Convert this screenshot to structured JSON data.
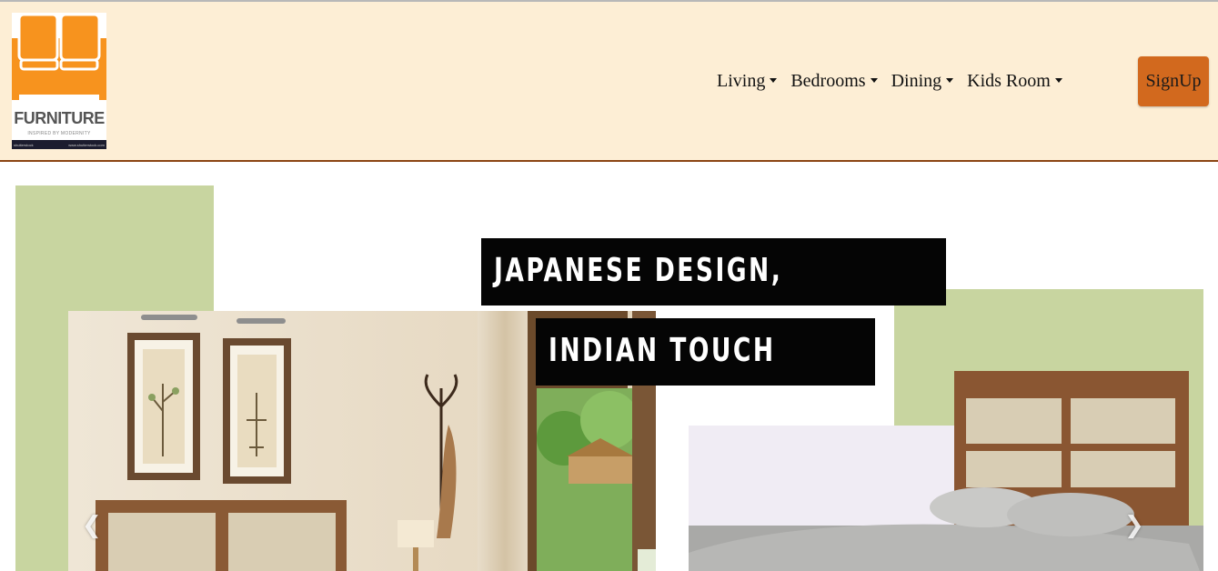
{
  "logo": {
    "title": "FURNITURE",
    "tagline": "INSPIRED BY MODERNITY",
    "strip_left": "shutterstock",
    "strip_right": "www.shutterstock.com"
  },
  "nav": {
    "items": [
      {
        "label": "Living"
      },
      {
        "label": "Bedrooms"
      },
      {
        "label": "Dining"
      },
      {
        "label": "Kids Room"
      }
    ],
    "signup_label": "SignUp"
  },
  "hero": {
    "line1": "JAPANESE DESIGN,",
    "line2": "INDIAN TOUCH",
    "prev_icon": "chevron-left-icon",
    "next_icon": "chevron-right-icon"
  },
  "colors": {
    "navbar_bg": "#fdeed5",
    "navbar_border": "#8b4513",
    "signup_bg": "#d2691e",
    "sage_green": "#c8d5a0",
    "banner_bg": "#050505"
  }
}
